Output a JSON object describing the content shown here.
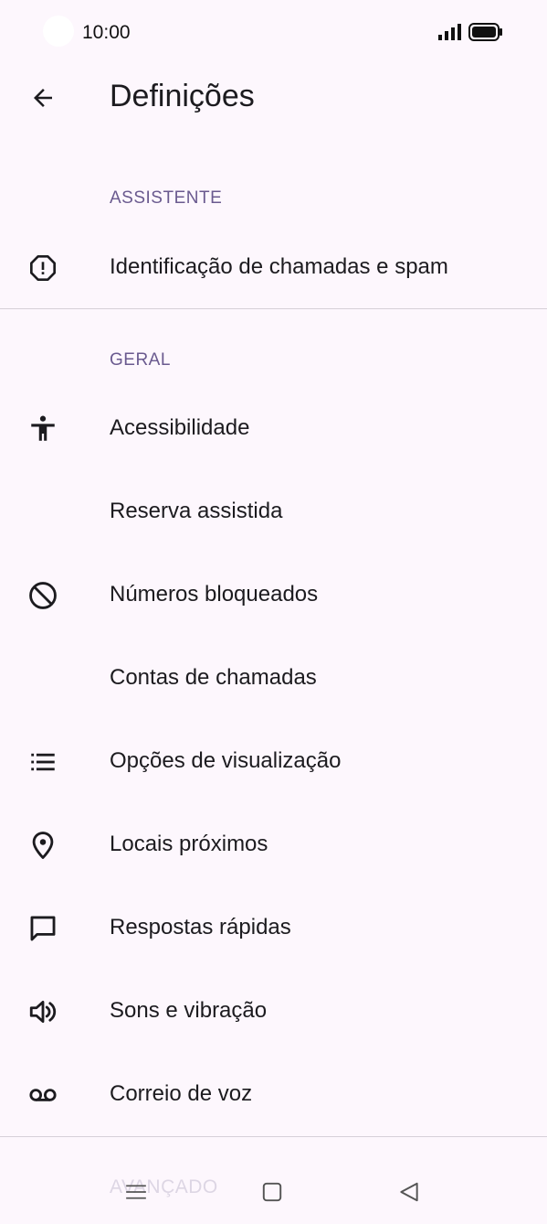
{
  "status_bar": {
    "time": "10:00"
  },
  "header": {
    "title": "Definições",
    "back_icon": "arrow-left-icon"
  },
  "sections": {
    "assistente": {
      "header": "ASSISTENTE",
      "items": [
        {
          "label": "Identificação de chamadas e spam",
          "icon": "alert-octagon-icon"
        }
      ]
    },
    "geral": {
      "header": "GERAL",
      "items": [
        {
          "label": "Acessibilidade",
          "icon": "accessibility-icon"
        },
        {
          "label": "Reserva assistida",
          "icon": ""
        },
        {
          "label": "Números bloqueados",
          "icon": "block-icon"
        },
        {
          "label": "Contas de chamadas",
          "icon": ""
        },
        {
          "label": "Opções de visualização",
          "icon": "list-icon"
        },
        {
          "label": "Locais próximos",
          "icon": "location-pin-icon"
        },
        {
          "label": "Respostas rápidas",
          "icon": "chat-bubble-icon"
        },
        {
          "label": "Sons e vibração",
          "icon": "volume-icon"
        },
        {
          "label": "Correio de voz",
          "icon": "voicemail-icon"
        }
      ]
    },
    "avancado": {
      "header": "AVANÇADO"
    }
  },
  "nav_bar": {
    "menu_icon": "menu-icon",
    "home_icon": "square-home-icon",
    "back_icon": "triangle-back-icon"
  },
  "colors": {
    "background": "#fdf7fd",
    "section_header": "#6a5a8f",
    "divider": "#d6d0d8",
    "text": "#1c1b1f"
  }
}
